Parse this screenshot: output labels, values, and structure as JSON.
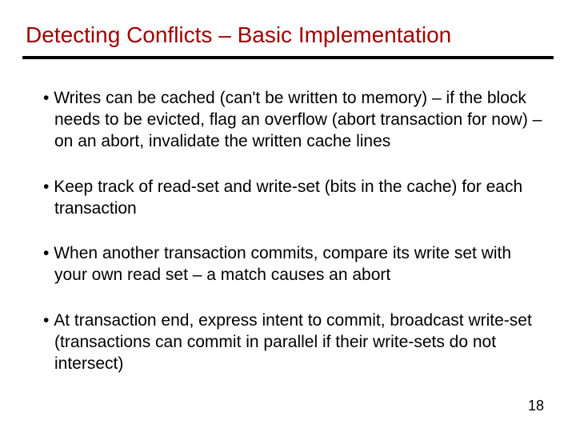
{
  "title": "Detecting Conflicts – Basic Implementation",
  "bullets": [
    "Writes can be cached (can't be written to memory) – if the block needs to be evicted, flag an overflow (abort transaction for now) – on an abort, invalidate the written cache lines",
    "Keep track of read-set and write-set (bits in the cache) for each transaction",
    "When another transaction commits, compare its write set with your own read set – a match causes an abort",
    "At transaction end, express intent to commit, broadcast write-set (transactions can commit in parallel if their write-sets do not intersect)"
  ],
  "page_number": "18"
}
